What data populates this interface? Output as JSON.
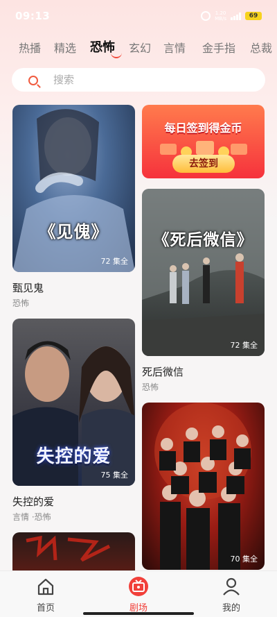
{
  "status": {
    "time": "09:13",
    "net_top": "1.20",
    "net_bottom": "MB/s",
    "battery": "69"
  },
  "tabs": [
    {
      "label": "热播"
    },
    {
      "label": "精选"
    },
    {
      "label": "恐怖"
    },
    {
      "label": "玄幻"
    },
    {
      "label": "言情"
    },
    {
      "label": "金手指"
    },
    {
      "label": "总裁"
    }
  ],
  "active_tab": "恐怖",
  "search": {
    "placeholder": "搜索"
  },
  "banner": {
    "headline": "每日签到得金币",
    "button": "去签到"
  },
  "dramas": [
    {
      "poster_title": "《见傀》",
      "episodes": "72 集全",
      "title": "甄见鬼",
      "tags": "恐怖"
    },
    {
      "poster_title": "《死后微信》",
      "episodes": "72 集全",
      "title": "死后微信",
      "tags": "恐怖"
    },
    {
      "poster_title": "失控的爱",
      "episodes": "75 集全",
      "title": "失控的爱",
      "tags": "言情 ·恐怖"
    },
    {
      "poster_title": "",
      "episodes": "70 集全",
      "title": "",
      "tags": ""
    }
  ],
  "nav": [
    {
      "label": "首页",
      "icon": "home-icon"
    },
    {
      "label": "剧场",
      "icon": "theater-icon"
    },
    {
      "label": "我的",
      "icon": "profile-icon"
    }
  ],
  "colors": {
    "accent": "#f1403a",
    "banner": "#f6323c"
  }
}
